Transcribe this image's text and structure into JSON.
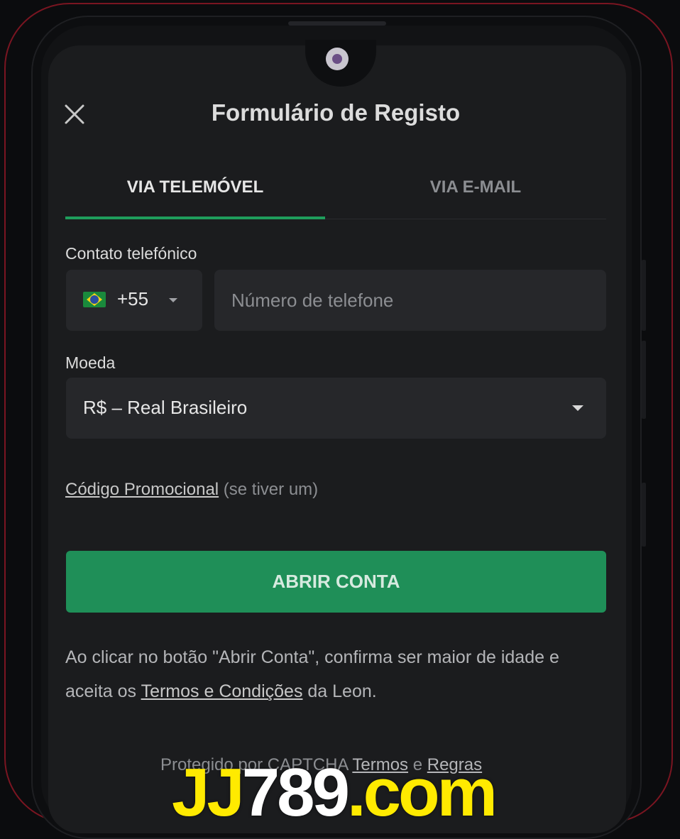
{
  "header": {
    "title": "Formulário de Registo",
    "close_icon": "close-icon"
  },
  "tabs": [
    {
      "label": "VIA TELEMÓVEL",
      "active": true
    },
    {
      "label": "VIA E-MAIL",
      "active": false
    }
  ],
  "phone": {
    "label": "Contato telefónico",
    "country_flag_icon": "brazil-flag-icon",
    "dial_code": "+55",
    "placeholder": "Número de telefone"
  },
  "currency": {
    "label": "Moeda",
    "value": "R$ – Real Brasileiro"
  },
  "promo": {
    "link": "Código Promocional",
    "suffix": "(se tiver um)"
  },
  "submit": {
    "label": "ABRIR CONTA"
  },
  "legal": {
    "text_before": "Ao clicar no botão \"Abrir Conta\", confirma ser maior de idade e aceita os ",
    "link": "Termos e Condições",
    "text_after": " da Leon."
  },
  "footer": {
    "prefix": "Protegido por CAPTCHA",
    "terms_link": "Termos",
    "conjunction": "e",
    "rules_link": "Regras"
  },
  "watermark": {
    "part_yellow_1": "JJ",
    "part_white": "789",
    "part_yellow_2": ".com"
  },
  "colors": {
    "accent_green": "#1f8f58",
    "tab_indicator": "#1f9d5c",
    "frame_border": "#7a1521",
    "background": "#1b1c1e",
    "watermark_yellow": "#ffea00"
  }
}
